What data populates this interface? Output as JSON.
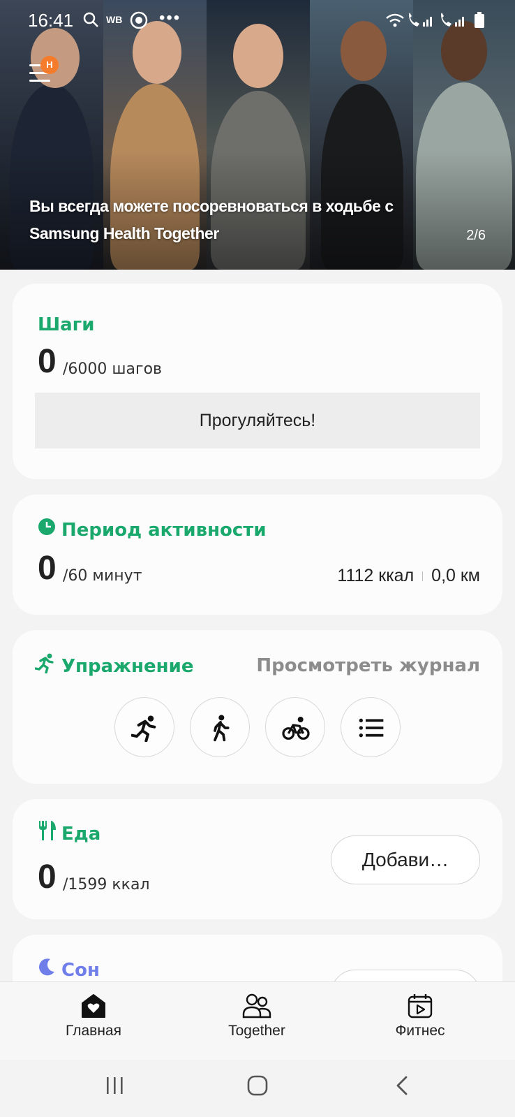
{
  "status_bar": {
    "time": "16:41",
    "left_icons": [
      "search-icon",
      "wb-icon",
      "vpn-icon",
      "more-dots-icon"
    ],
    "right_icons": [
      "wifi-icon",
      "call-sim1-icon",
      "signal-icon",
      "call-sim2-icon",
      "signal-icon",
      "battery-icon"
    ],
    "wb_label": "WB"
  },
  "hero": {
    "badge": "H",
    "text": "Вы всегда можете посоревноваться в ходьбе с Samsung Health Together",
    "page_indicator": "2/6"
  },
  "steps": {
    "title": "Шаги",
    "value": "0",
    "goal": "/6000 шагов",
    "button": "Прогуляйтесь!"
  },
  "active": {
    "title": "Период активности",
    "value": "0",
    "goal": "/60 минут",
    "calories": "1112 ккал",
    "distance": "0,0 км"
  },
  "exercise": {
    "title": "Упражнение",
    "log_link": "Просмотреть журнал",
    "buttons": [
      "running-icon",
      "walking-icon",
      "cycling-icon",
      "list-icon"
    ]
  },
  "food": {
    "title": "Еда",
    "value": "0",
    "goal": "/1599 ккал",
    "button": "Добави…"
  },
  "sleep": {
    "title": "Сон"
  },
  "bottom_nav": {
    "items": [
      {
        "label": "Главная",
        "icon": "home-heart-icon"
      },
      {
        "label": "Together",
        "icon": "people-icon"
      },
      {
        "label": "Фитнес",
        "icon": "fitness-calendar-icon"
      }
    ]
  },
  "colors": {
    "accent_green": "#1aa86d",
    "sleep_blue": "#6f7ee8",
    "badge_orange": "#f57c2a"
  }
}
